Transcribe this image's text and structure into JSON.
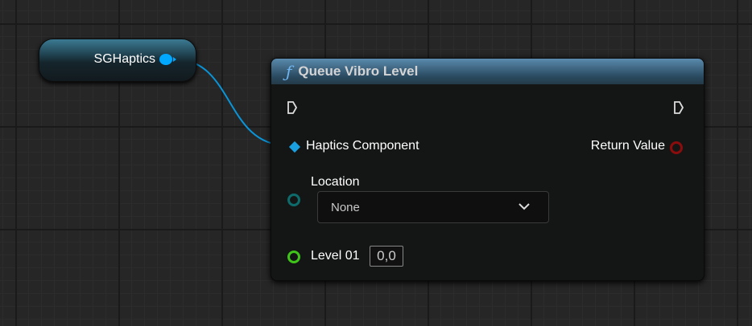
{
  "variable_node": {
    "label": "SGHaptics",
    "pin_color": "#00a8ff"
  },
  "function_node": {
    "icon": "function-icon",
    "icon_glyph": "ƒ",
    "title": "Queue Vibro Level",
    "header_color": "#4a7a9c",
    "inputs": {
      "haptics_component": "Haptics Component",
      "location": {
        "label": "Location",
        "selected": "None"
      },
      "level": {
        "label": "Level 01",
        "value": "0,0"
      }
    },
    "outputs": {
      "return_value": "Return Value"
    },
    "pin_colors": {
      "object": "#1aa0e0",
      "enum": "#0e6b6b",
      "float": "#3fc41a",
      "return": "#8a0c0c"
    }
  }
}
